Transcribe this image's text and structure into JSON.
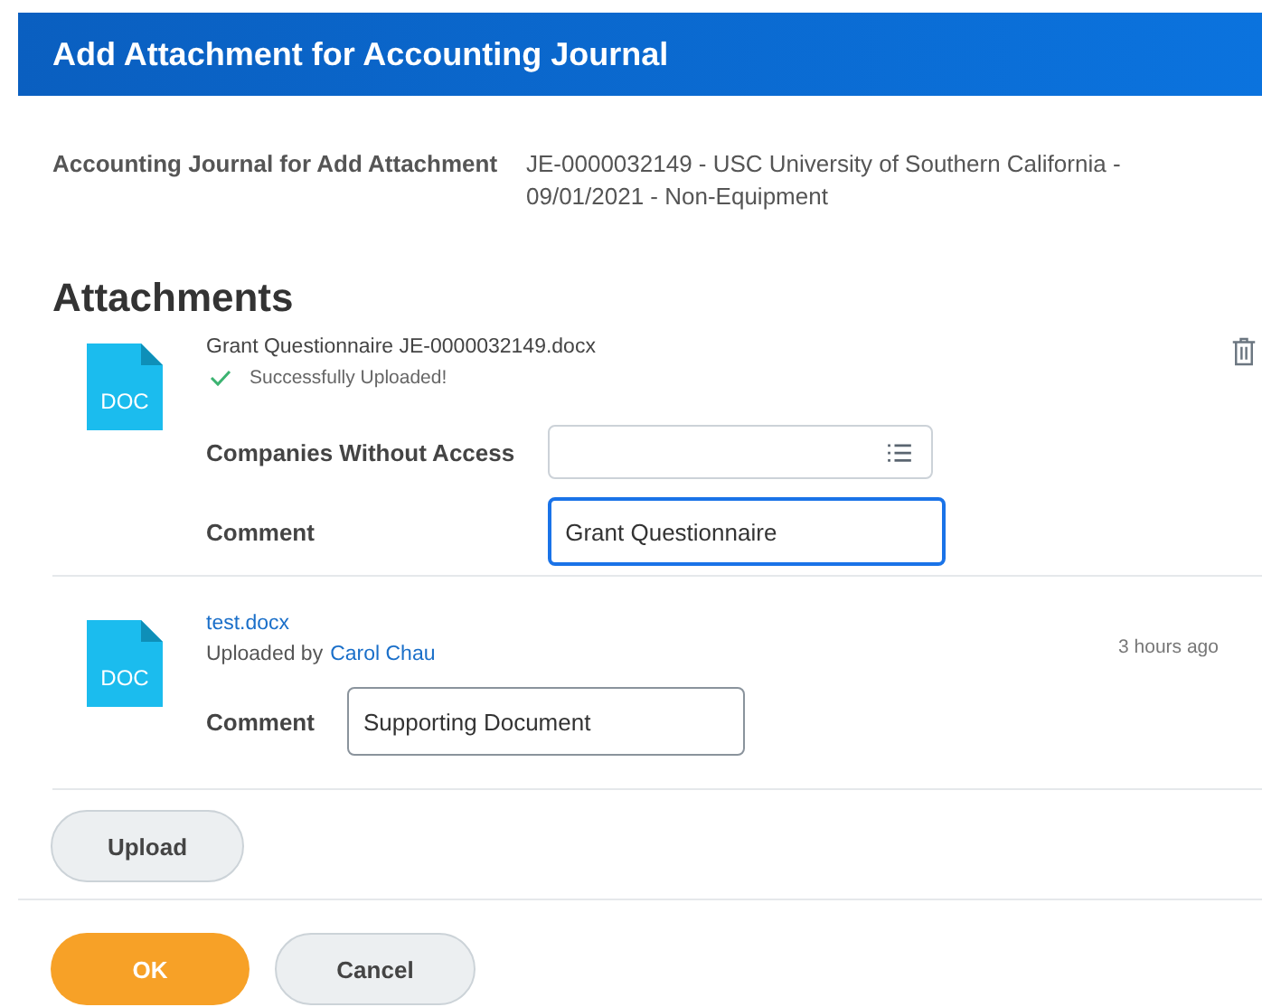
{
  "header": {
    "title": "Add Attachment for Accounting Journal"
  },
  "journal": {
    "label": "Accounting Journal for Add Attachment",
    "value": "JE-0000032149 - USC University of Southern California - 09/01/2021 - Non-Equipment"
  },
  "attachments_title": "Attachments",
  "attachments": [
    {
      "kind": "new",
      "file_type": "DOC",
      "file_name": "Grant Questionnaire JE-0000032149.docx",
      "status": "Successfully Uploaded!",
      "deletable": true,
      "fields": [
        {
          "label": "Companies Without Access",
          "kind": "prompt",
          "focused": false
        },
        {
          "label": "Comment",
          "kind": "text",
          "value": "Grant Questionnaire",
          "focused": true
        }
      ]
    },
    {
      "kind": "existing",
      "file_type": "DOC",
      "file_name": "test.docx",
      "uploaded_by_prefix": "Uploaded by",
      "uploaded_by": "Carol Chau",
      "time": "3 hours ago",
      "deletable": false,
      "fields": [
        {
          "label": "Comment",
          "kind": "text",
          "value": "Supporting Document",
          "focused": false
        }
      ]
    }
  ],
  "upload_button": "Upload",
  "buttons": [
    {
      "label": "OK",
      "kind": "primary"
    },
    {
      "label": "Cancel",
      "kind": "secondary"
    }
  ]
}
